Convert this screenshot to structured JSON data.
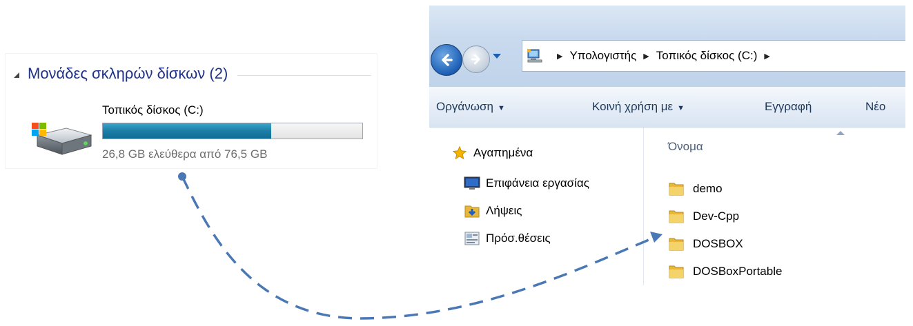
{
  "drives": {
    "group_title": "Μονάδες σκληρών δίσκων (2)",
    "drive_name": "Τοπικός δίσκος (C:)",
    "space_text": "26,8 GB ελεύθερα από 76,5 GB",
    "used_fraction": 0.65,
    "bar_color": "#1c7ea6"
  },
  "explorer": {
    "breadcrumb": [
      "Υπολογιστής",
      "Τοπικός δίσκος (C:)"
    ],
    "toolbar": {
      "organize": "Οργάνωση",
      "share": "Κοινή χρήση με",
      "burn": "Εγγραφή",
      "new": "Νέο"
    },
    "nav": {
      "favorites": "Αγαπημένα",
      "desktop": "Επιφάνεια εργασίας",
      "downloads": "Λήψεις",
      "recent": "Πρόσ.θέσεις"
    },
    "column_name": "Όνομα",
    "files": [
      "demo",
      "Dev-Cpp",
      "DOSBOX",
      "DOSBoxPortable"
    ]
  },
  "colors": {
    "accent": "#1e3287",
    "connector": "#4a78b5",
    "folder": "#e7b83c"
  },
  "icons": [
    "drive-icon",
    "computer-icon",
    "back-arrow-icon",
    "forward-arrow-icon",
    "star-icon",
    "desktop-icon",
    "downloads-icon",
    "recent-places-icon",
    "folder-icon"
  ]
}
